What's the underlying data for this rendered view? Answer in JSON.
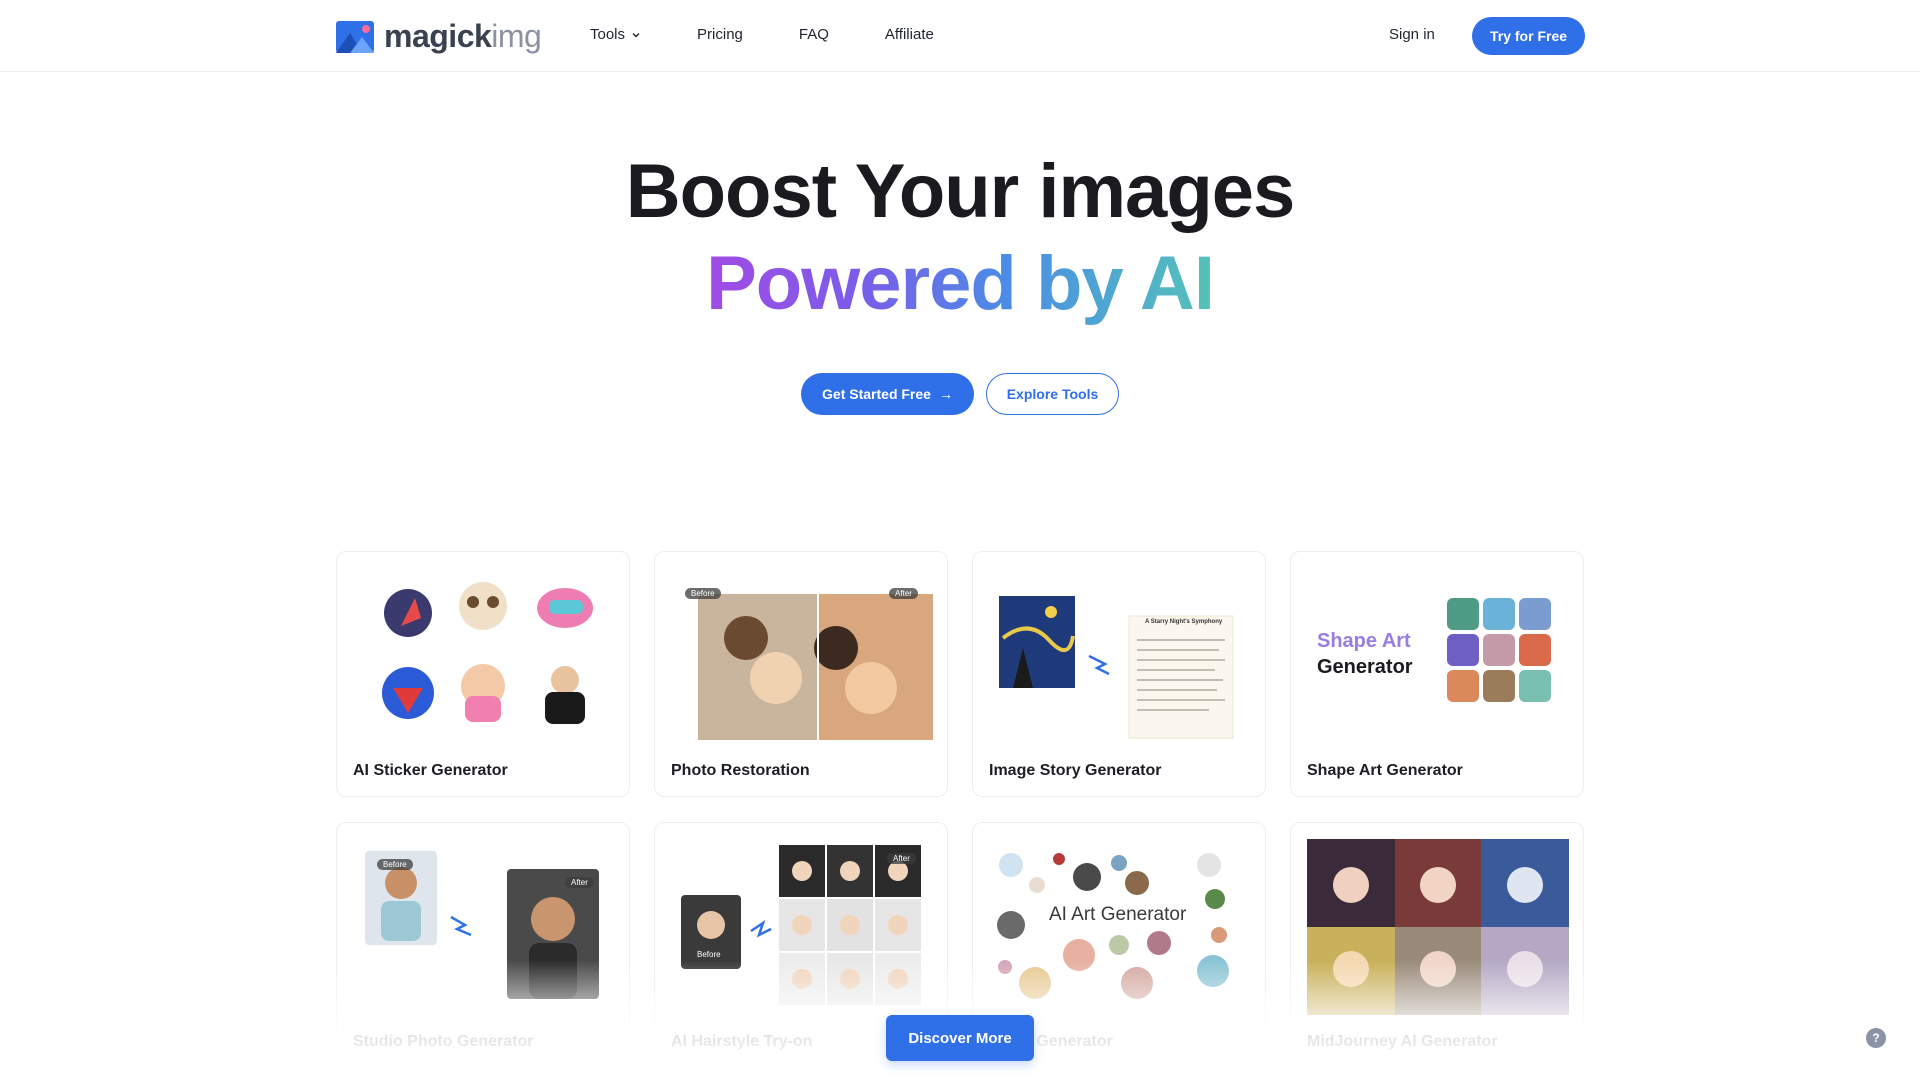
{
  "header": {
    "logo": {
      "text_main": "magick",
      "text_accent": "img"
    },
    "nav": [
      {
        "label": "Tools",
        "has_dropdown": true
      },
      {
        "label": "Pricing"
      },
      {
        "label": "FAQ"
      },
      {
        "label": "Affiliate"
      }
    ],
    "sign_in": "Sign in",
    "try_free": "Try for Free"
  },
  "hero": {
    "line1": "Boost Your images",
    "line2": "Powered by AI",
    "primary_cta": "Get Started Free",
    "primary_cta_arrow": "→",
    "secondary_cta": "Explore Tools"
  },
  "tools": [
    {
      "label": "AI Sticker Generator",
      "icon": "stickers-preview"
    },
    {
      "label": "Photo Restoration",
      "icon": "photo-before-after",
      "tags": [
        "Before",
        "After"
      ]
    },
    {
      "label": "Image Story Generator",
      "icon": "painting-to-story",
      "story_title": "A Starry Night's Symphony"
    },
    {
      "label": "Shape Art Generator",
      "icon": "shape-art-grid",
      "art_text_1": "Shape Art",
      "art_text_2": "Generator"
    },
    {
      "label": "Studio Photo Generator",
      "icon": "portrait-before-after",
      "tags": [
        "Before",
        "After"
      ]
    },
    {
      "label": "AI Hairstyle Try-on",
      "icon": "hairstyle-grid",
      "tags": [
        "Before",
        "After"
      ]
    },
    {
      "label": "AI Art Generator",
      "icon": "art-bubbles",
      "art_text": "AI Art Generator"
    },
    {
      "label": "MidJourney AI Generator",
      "icon": "anime-collage"
    }
  ],
  "discover_more": "Discover More",
  "help_icon": "?",
  "colors": {
    "primary": "#2f6fe8",
    "gradient": [
      "#a24be6",
      "#4a8ee6",
      "#55c2b8"
    ]
  }
}
